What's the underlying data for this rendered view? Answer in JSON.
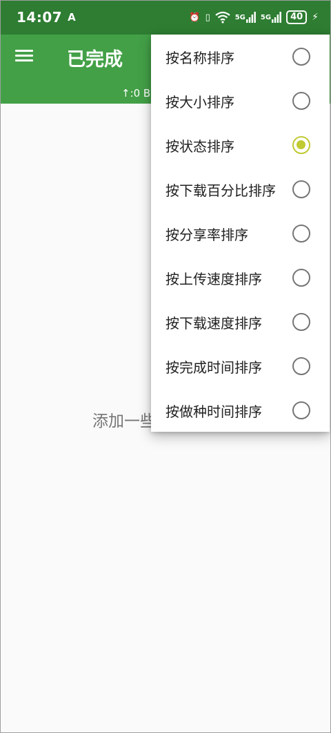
{
  "status_bar": {
    "time": "14:07",
    "app_icon": "A",
    "alarm_icon": "⏰",
    "vibrate_icon": "▯",
    "wifi_icon": "wifi-6",
    "signal1_label": "5G",
    "signal2_label": "5G",
    "battery": "40",
    "charging_icon": "⚡"
  },
  "app_bar": {
    "title": "已完成",
    "speed_text": "↑:0 B"
  },
  "empty_hint": "添加一些",
  "sort_menu": {
    "items": [
      {
        "label": "按名称排序",
        "selected": false
      },
      {
        "label": "按大小排序",
        "selected": false
      },
      {
        "label": "按状态排序",
        "selected": true
      },
      {
        "label": "按下载百分比排序",
        "selected": false
      },
      {
        "label": "按分享率排序",
        "selected": false
      },
      {
        "label": "按上传速度排序",
        "selected": false
      },
      {
        "label": "按下载速度排序",
        "selected": false
      },
      {
        "label": "按完成时间排序",
        "selected": false
      },
      {
        "label": "按做种时间排序",
        "selected": false
      }
    ],
    "accent_color": "#c0ca33"
  },
  "colors": {
    "status_bar": "#2e7d32",
    "app_bar": "#43a047",
    "background": "#fafafa"
  }
}
